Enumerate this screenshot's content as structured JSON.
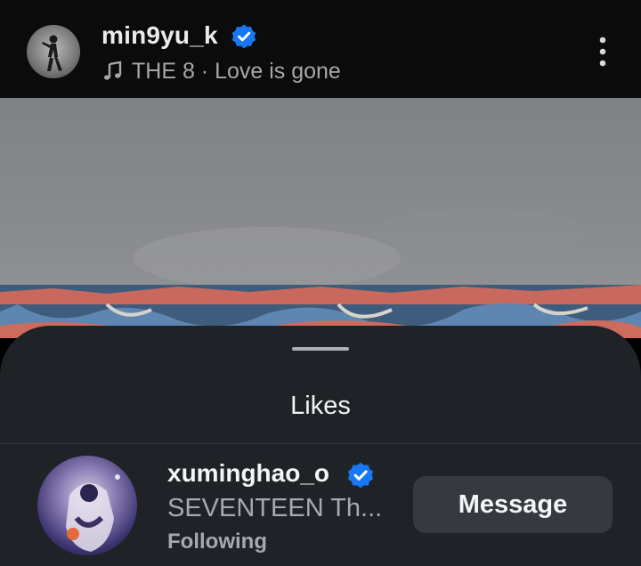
{
  "post": {
    "username": "min9yu_k",
    "verified_icon": "verified-badge-icon",
    "music": "THE 8 · Love is gone",
    "music_icon": "music-note-icon",
    "more_icon": "more-vertical-icon"
  },
  "likes_sheet": {
    "title": "Likes",
    "items": [
      {
        "username": "xuminghao_o",
        "subtitle": "SEVENTEEN Th...",
        "status": "Following",
        "button_label": "Message"
      }
    ]
  },
  "colors": {
    "header_bg": "#0b0b0b",
    "sheet_bg": "#1f2226",
    "verified_blue": "#1877f2",
    "button_bg": "#363a40"
  }
}
